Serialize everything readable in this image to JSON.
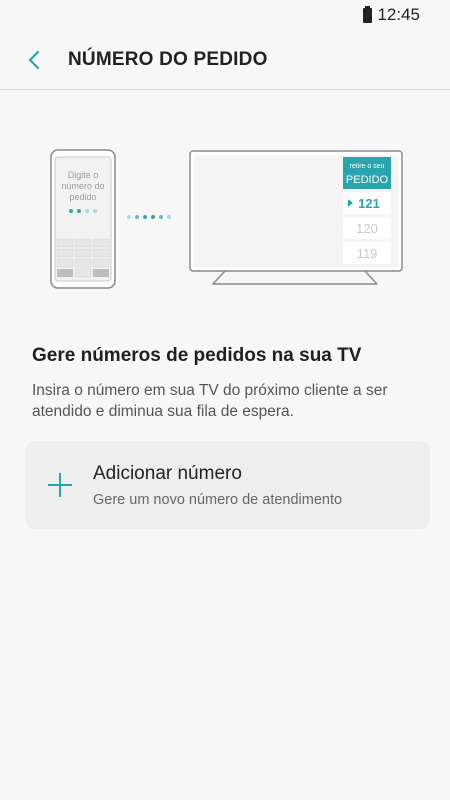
{
  "status": {
    "time": "12:45"
  },
  "header": {
    "title": "NÚMERO DO PEDIDO"
  },
  "illustration": {
    "phone_text": [
      "Digite o",
      "número do",
      "pedido"
    ],
    "tv_banner_small": "retire o seu",
    "tv_banner_big": "PEDIDO",
    "tv_numbers": [
      "121",
      "120",
      "119"
    ],
    "accent_color": "#2aa4ad"
  },
  "main": {
    "headline": "Gere números de pedidos na sua TV",
    "description": "Insira o número em sua TV do próximo cliente a ser atendido e diminua sua fila de espera."
  },
  "add_card": {
    "title": "Adicionar número",
    "subtitle": "Gere um novo número de atendimento",
    "icon": "plus-icon"
  }
}
